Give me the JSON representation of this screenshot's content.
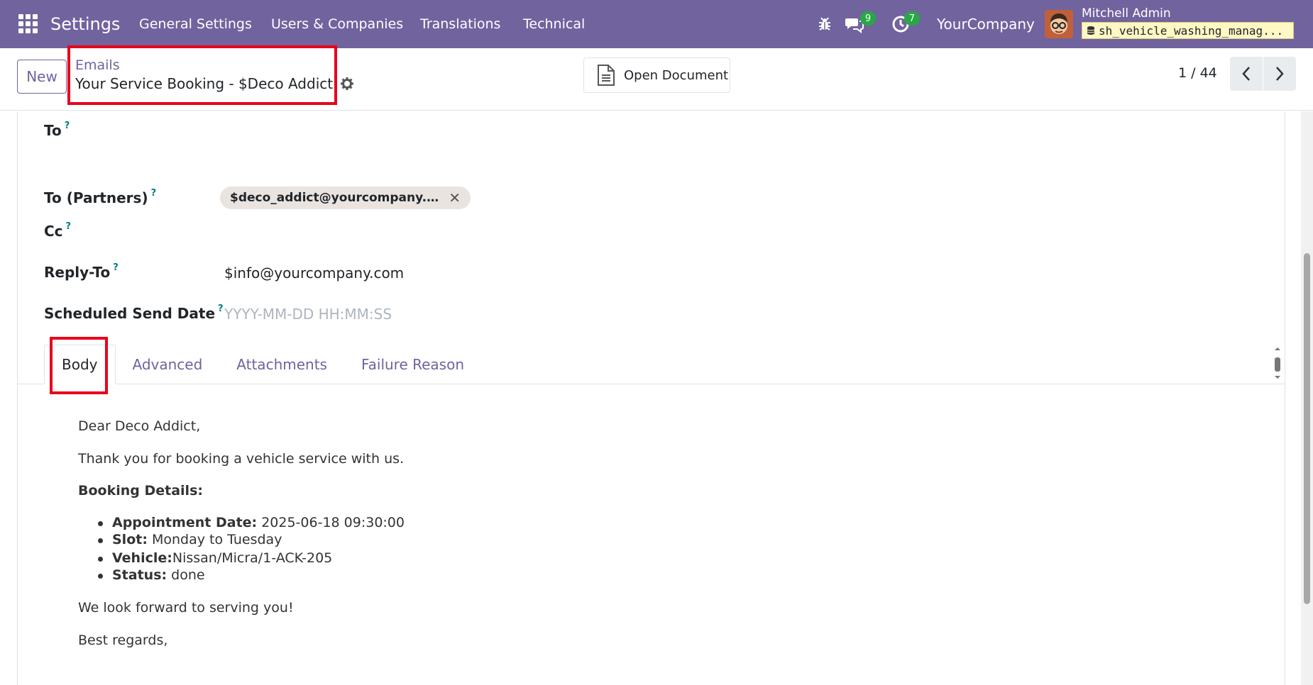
{
  "navbar": {
    "brand": "Settings",
    "menu": [
      "General Settings",
      "Users & Companies",
      "Translations",
      "Technical"
    ],
    "messages_count": "9",
    "activities_count": "7",
    "company": "YourCompany",
    "user_name": "Mitchell Admin",
    "database": "sh_vehicle_washing_manag..."
  },
  "control_panel": {
    "new_label": "New",
    "breadcrumb_parent": "Emails",
    "breadcrumb_current": "Your Service Booking - $Deco Addict",
    "open_document_label": "Open Document",
    "pager": "1 / 44"
  },
  "form": {
    "to_label": "To",
    "to_partners_label": "To (Partners)",
    "partner_tag": "$deco_addict@yourcompany.exa...",
    "cc_label": "Cc",
    "reply_to_label": "Reply-To",
    "reply_to_value": "$info@yourcompany.com",
    "scheduled_label": "Scheduled Send Date",
    "scheduled_placeholder": "YYYY-MM-DD HH:MM:SS",
    "help_mark": "?"
  },
  "tabs": [
    "Body",
    "Advanced",
    "Attachments",
    "Failure Reason"
  ],
  "email_body": {
    "greeting": "Dear Deco Addict,",
    "intro": "Thank you for booking a vehicle service with us.",
    "details_heading": "Booking Details:",
    "details": [
      {
        "label": "Appointment Date:",
        "value": " 2025-06-18 09:30:00"
      },
      {
        "label": "Slot:",
        "value": " Monday to Tuesday"
      },
      {
        "label": "Vehicle:",
        "value": "Nissan/Micra/1-ACK-205"
      },
      {
        "label": "Status:",
        "value": " done"
      }
    ],
    "closing": "We look forward to serving you!",
    "regards": "Best regards,"
  }
}
